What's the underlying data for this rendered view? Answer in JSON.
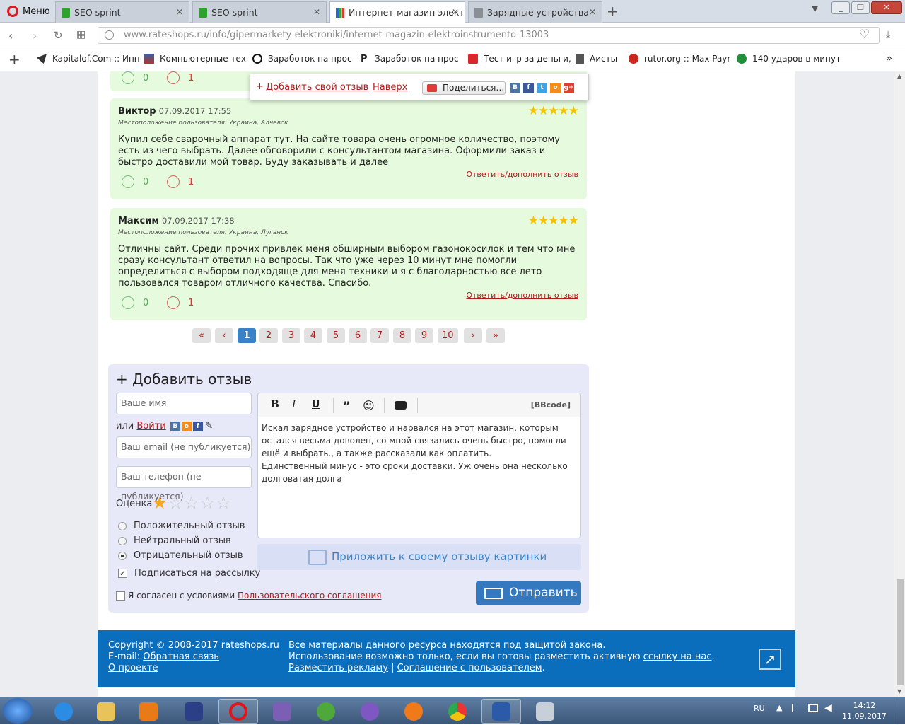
{
  "browser": {
    "menu_label": "Меню",
    "tabs": [
      {
        "label": "SEO sprint",
        "active": false
      },
      {
        "label": "SEO sprint",
        "active": false
      },
      {
        "label": "Интернет-магазин электр",
        "active": true
      },
      {
        "label": "Зарядные устройства",
        "active": false
      }
    ],
    "new_tab": "+",
    "url": "www.rateshops.ru/info/gipermarkety-elektroniki/internet-magazin-elektroinstrumento-13003",
    "bookmarks": [
      "Kapitalof.Com :: Инн",
      "Компьютерные тех",
      "Заработок на прос",
      "Заработок на прос",
      "Тест игр за деньги,",
      "Аисты",
      "rutor.org :: Max Payr",
      "140 ударов в минут"
    ]
  },
  "toolbar": {
    "add_review": "Добавить свой отзыв",
    "top": "Наверх",
    "share": "Поделиться…"
  },
  "prev_votes": {
    "up": "0",
    "down": "1"
  },
  "reviews": [
    {
      "name": "Виктор",
      "date": "07.09.2017 17:55",
      "location": "Местоположение пользователя: Украина, Алчевск",
      "stars": "★★★★★",
      "text": "Купил себе сварочный аппарат тут. На сайте товара очень огромное количество, поэтому есть из чего выбрать. Далее обговорили с консультантом магазина. Оформили заказ и быстро доставили мой товар. Буду заказывать и далее",
      "reply": "Ответить/дополнить отзыв",
      "up": "0",
      "down": "1"
    },
    {
      "name": "Максим",
      "date": "07.09.2017 17:38",
      "location": "Местоположение пользователя: Украина, Луганск",
      "stars": "★★★★★",
      "text": "Отличны сайт. Среди прочих привлек меня обширным выбором газонокосилок и тем что мне сразу консультант ответил на вопросы. Так что уже через 10 минут мне помогли определиться с выбором подходяще для меня техники и я с благодарностью все лето пользовался товаром отличного качества. Спасибо.",
      "reply": "Ответить/дополнить отзыв",
      "up": "0",
      "down": "1"
    }
  ],
  "pagination": [
    "«",
    "‹",
    "1",
    "2",
    "3",
    "4",
    "5",
    "6",
    "7",
    "8",
    "9",
    "10",
    "›",
    "»"
  ],
  "pagination_current": "1",
  "form": {
    "title": "+ Добавить отзыв",
    "name_placeholder": "Ваше имя",
    "or_label": "или",
    "login_link": "Войти",
    "email_placeholder": "Ваш email (не публикуется)",
    "phone_placeholder": "Ваш телефон (не публикуется)",
    "rating_label": "Оценка",
    "rating": 1,
    "rating_max": 5,
    "radios": [
      "Положительный отзыв",
      "Нейтральный отзыв",
      "Отрицательный отзыв"
    ],
    "radio_selected": "Отрицательный отзыв",
    "subscribe": "Подписаться на рассылку",
    "subscribe_checked": true,
    "agree_prefix": "Я согласен с условиями",
    "agree_link": "Пользовательского соглашения",
    "bbcode": "[BBcode]",
    "editor_lines": [
      "Искал зарядное устройство и нарвался на этот магазин, которым остался весьма доволен, со мной связались очень быстро, помогли ещё и выбрать., а также рассказали как оплатить.",
      "Единственный минус - это сроки доставки. Уж очень она несколько долговатая долга"
    ],
    "attach": "Приложить к своему отзыву картинки",
    "send": "Отправить"
  },
  "footer": {
    "copyright": "Copyright © 2008-2017 rateshops.ru",
    "email_label": "E-mail:",
    "feedback": "Обратная связь",
    "about": "О проекте",
    "line1": "Все материалы данного ресурса находятся под защитой закона.",
    "line2": "Использование возможно только, если вы готовы разместить активную",
    "link_us": "ссылку на нас",
    "ads": "Разместить рекламу",
    "sep": "|",
    "agreement": "Соглашение с пользователем"
  },
  "taskbar": {
    "lang": "RU",
    "time": "14:12",
    "date": "11.09.2017"
  },
  "colors": {
    "review_bg": "#e6fbde",
    "link_red": "#b01b1b",
    "footer_blue": "#0a6ebd",
    "active_page": "#3a82c8",
    "star": "#f6c200"
  }
}
